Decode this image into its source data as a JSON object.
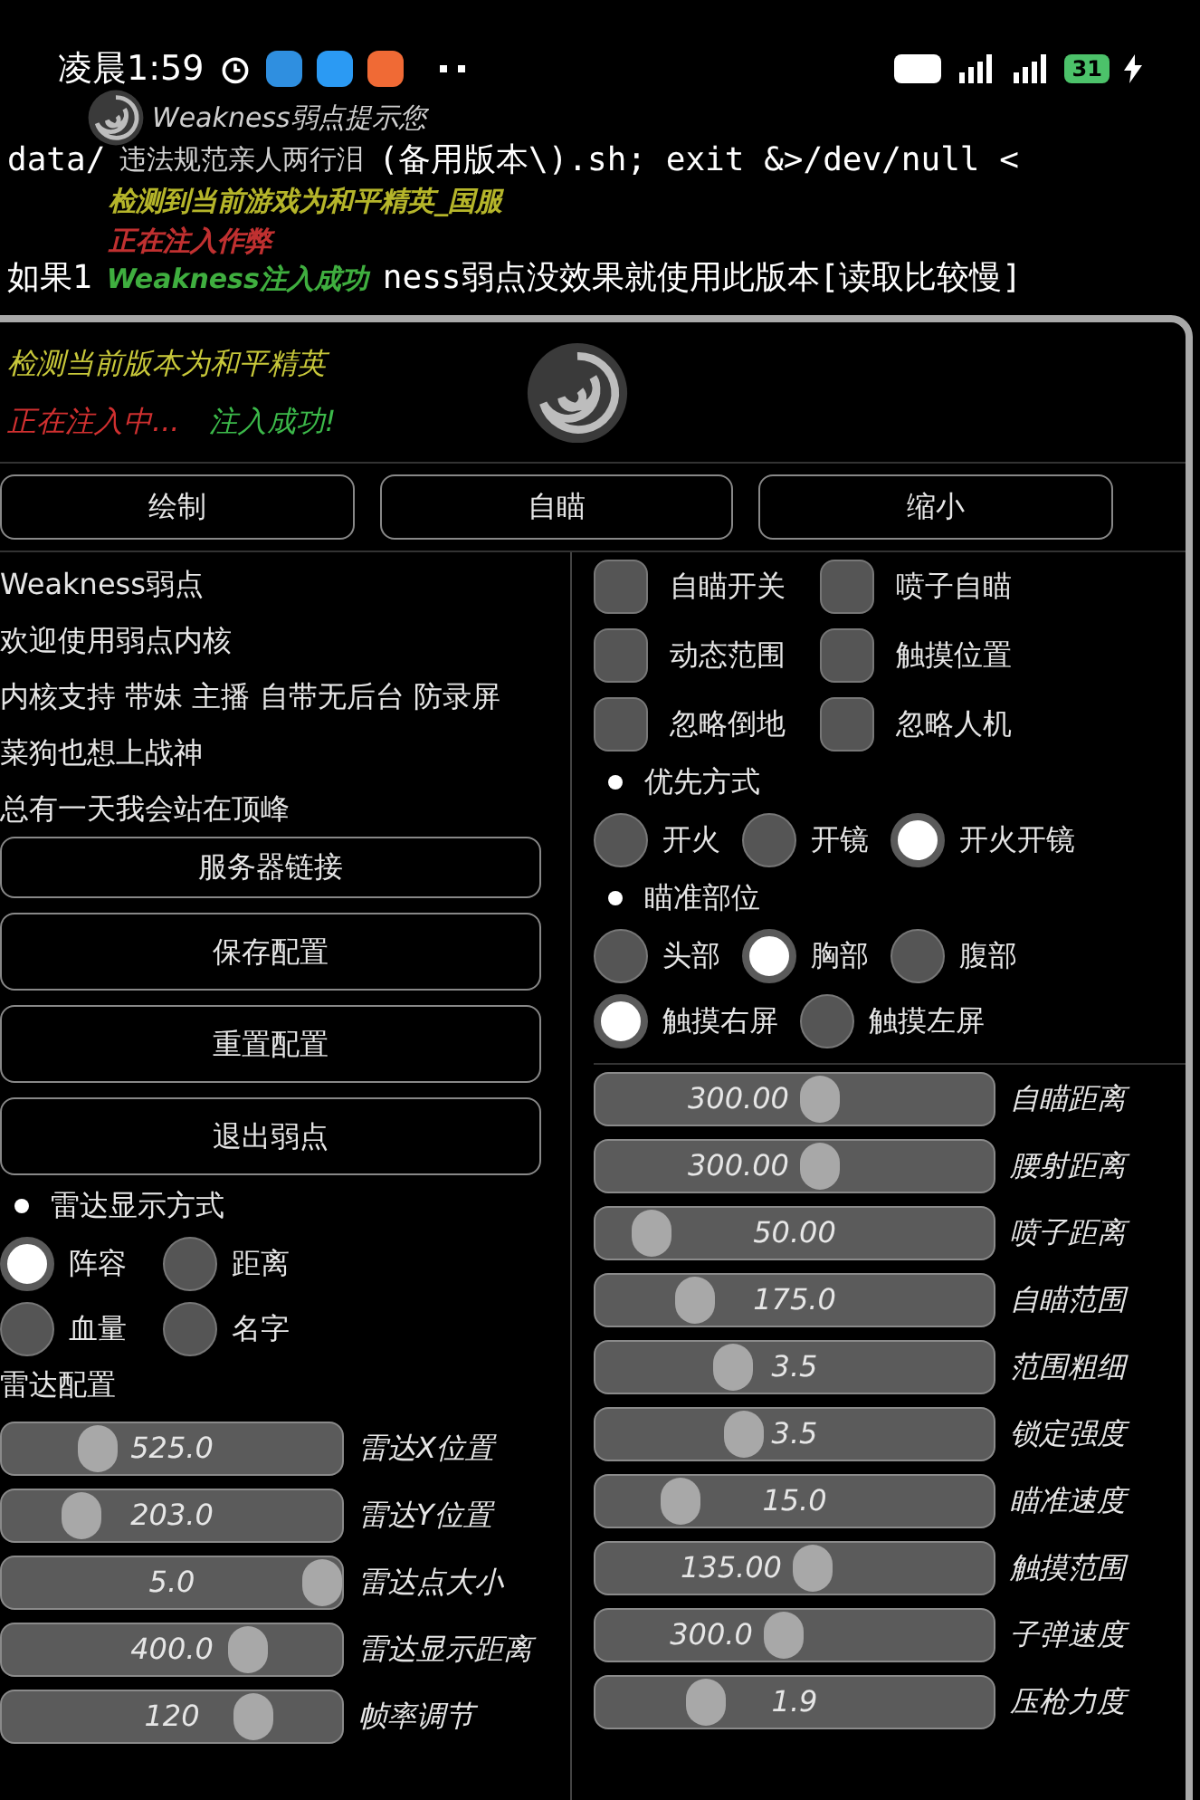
{
  "status_bar": {
    "time": "凌晨1:59",
    "battery": "31"
  },
  "toast": {
    "title": "Weakness弱点提示您",
    "warning": "违法规范亲人两行泪",
    "detected": "检测到当前游戏为和平精英_国服",
    "injecting": "正在注入作弊",
    "success": "Weakness注入成功"
  },
  "terminal": {
    "line_1_start": "data/",
    "line_1_end": "(备用版本\\).sh; exit &>/dev/null <",
    "line_2_start": "如果1",
    "line_2_end": "ness弱点没效果就使用此版本[读取比较慢]"
  },
  "panel": {
    "detected_text": "检测当前版本为和平精英",
    "injecting_text": "正在注入中...",
    "success_text": "注入成功!",
    "tabs": [
      {
        "label": "绘制",
        "selected": false
      },
      {
        "label": "自瞄",
        "selected": false
      },
      {
        "label": "缩小",
        "selected": false
      }
    ],
    "info_lines": [
      "Weakness弱点",
      "欢迎使用弱点内核",
      "内核支持 带妹 主播 自带无后台 防录屏",
      "菜狗也想上战神",
      "总有一天我会站在顶峰"
    ],
    "buttons": [
      "服务器链接",
      "保存配置",
      "重置配置",
      "退出弱点"
    ],
    "radar_mode": {
      "title": "雷达显示方式",
      "options": [
        {
          "label": "阵容",
          "selected": true
        },
        {
          "label": "距离",
          "selected": false
        },
        {
          "label": "血量",
          "selected": false
        },
        {
          "label": "名字",
          "selected": false
        }
      ]
    },
    "radar_config_title": "雷达配置",
    "radar_sliders": [
      {
        "label": "雷达X位置",
        "reading": "525.0",
        "level": 0.25
      },
      {
        "label": "雷达Y位置",
        "reading": "203.0",
        "level": 0.2
      },
      {
        "label": "雷达点大小",
        "reading": "5.0",
        "level": 1
      },
      {
        "label": "雷达显示距离",
        "reading": "400.0",
        "level": 0.75
      },
      {
        "label": "帧率调节",
        "reading": "120",
        "level": 0.77
      }
    ],
    "toggles": [
      {
        "label": "自瞄开关",
        "checked": false
      },
      {
        "label": "喷子自瞄",
        "checked": false
      },
      {
        "label": "动态范围",
        "checked": false
      },
      {
        "label": "触摸位置",
        "checked": false
      },
      {
        "label": "忽略倒地",
        "checked": false
      },
      {
        "label": "忽略人机",
        "checked": false
      }
    ],
    "priority": {
      "title": "优先方式",
      "options": [
        {
          "label": "开火",
          "selected": false
        },
        {
          "label": "开镜",
          "selected": false
        },
        {
          "label": "开火开镜",
          "selected": true
        }
      ]
    },
    "aim_part": {
      "title": "瞄准部位",
      "options": [
        {
          "label": "头部",
          "selected": false
        },
        {
          "label": "胸部",
          "selected": true
        },
        {
          "label": "腹部",
          "selected": false
        },
        {
          "label": "触摸右屏",
          "selected": true
        },
        {
          "label": "触摸左屏",
          "selected": false
        }
      ]
    },
    "aim_sliders": [
      {
        "label": "自瞄距离",
        "reading": "300.00",
        "level": 0.57
      },
      {
        "label": "腰射距离",
        "reading": "300.00",
        "level": 0.57
      },
      {
        "label": "喷子距离",
        "reading": "50.00",
        "level": 0.1
      },
      {
        "label": "自瞄范围",
        "reading": "175.0",
        "level": 0.22
      },
      {
        "label": "范围粗细",
        "reading": "3.5",
        "level": 0.33
      },
      {
        "label": "锁定强度",
        "reading": "3.5",
        "level": 0.36
      },
      {
        "label": "瞄准速度",
        "reading": "15.0",
        "level": 0.18
      },
      {
        "label": "触摸范围",
        "reading": "135.00",
        "level": 0.55
      },
      {
        "label": "子弹速度",
        "reading": "300.0",
        "level": 0.47
      },
      {
        "label": "压枪力度",
        "reading": "1.9",
        "level": 0.25
      }
    ]
  }
}
